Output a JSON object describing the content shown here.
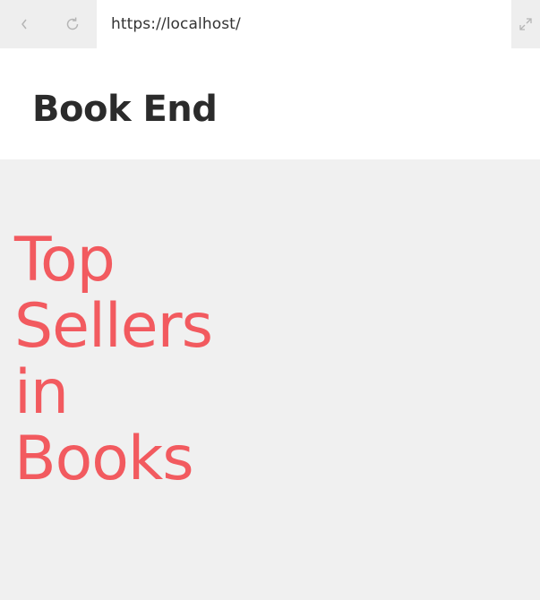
{
  "browser": {
    "url": "https://localhost/",
    "back_icon": "chevron-left-icon",
    "reload_icon": "reload-icon",
    "expand_icon": "expand-icon"
  },
  "header": {
    "title": "Book End"
  },
  "hero": {
    "heading_lines": [
      "Top",
      "Sellers",
      "in",
      "Books"
    ]
  },
  "colors": {
    "accent": "#f25a5f",
    "background": "#f0f0f0",
    "header_bg": "#ffffff",
    "title_text": "#2b2b2b"
  }
}
